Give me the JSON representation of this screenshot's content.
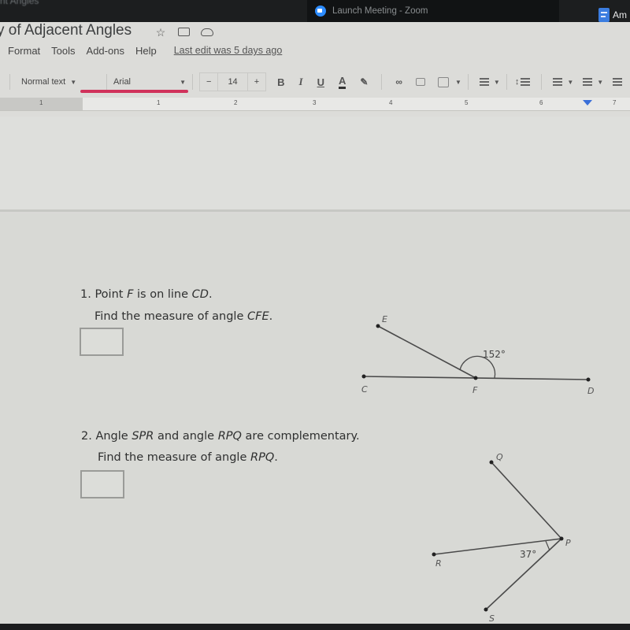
{
  "os_bar": {
    "window_title": "nt Angles",
    "zoom_tab_label": "Launch Meeting - Zoom",
    "docs_tab_label": "Am"
  },
  "doc": {
    "title": "y of Adjacent Angles",
    "title_icons": [
      "star-icon",
      "move-to-folder-icon",
      "cloud-status-icon"
    ],
    "menu": [
      "Format",
      "Tools",
      "Add-ons",
      "Help"
    ],
    "last_edit": "Last edit was 5 days ago"
  },
  "toolbar": {
    "style": "Normal text",
    "font": "Arial",
    "font_size": "14",
    "decrease": "−",
    "increase": "+",
    "bold": "B",
    "italic": "I",
    "underline": "U",
    "text_color": "A"
  },
  "ruler": {
    "labels": [
      "1",
      "1",
      "2",
      "3",
      "4",
      "5",
      "6",
      "7"
    ]
  },
  "questions": [
    {
      "number_text": "1. Point ",
      "line1_parts": [
        "1. Point ",
        "F",
        " is on line ",
        "CD",
        "."
      ],
      "line2_parts": [
        "Find the measure of angle ",
        "CFE",
        "."
      ],
      "answer": "",
      "diagram": {
        "points": [
          "E",
          "C",
          "F",
          "D"
        ],
        "angle_label": "152°"
      }
    },
    {
      "line1_parts": [
        "2. Angle ",
        "SPR",
        " and angle ",
        "RPQ",
        " are complementary."
      ],
      "line2_parts": [
        "Find the measure of angle ",
        "RPQ",
        "."
      ],
      "answer": "",
      "diagram": {
        "points": [
          "Q",
          "P",
          "R",
          "S"
        ],
        "angle_label": "37°"
      }
    }
  ],
  "colors": {
    "accent_red": "#d0325b",
    "zoom_blue": "#2d8cff",
    "docs_blue": "#3b7de0"
  }
}
